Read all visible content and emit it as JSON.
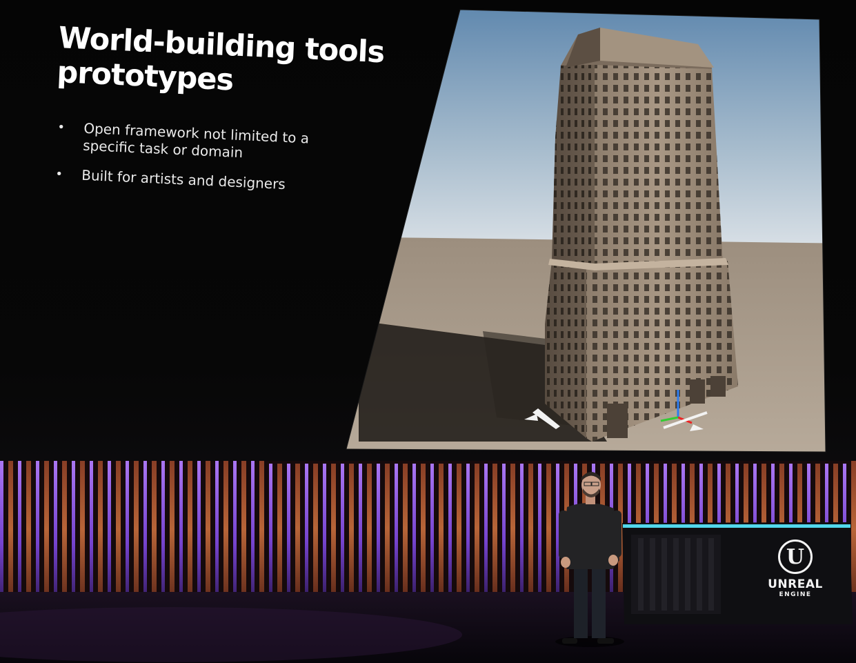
{
  "slide": {
    "title_line1": "World-building tools",
    "title_line2": "prototypes",
    "bullets": [
      "Open framework not limited to a specific task or domain",
      "Built for artists and designers"
    ]
  },
  "podium_logo": {
    "mark": "U",
    "line1": "UNREAL",
    "line2": "ENGINE"
  },
  "colors": {
    "sky_top": "#5d86ad",
    "sky_bottom": "#d9e0e6",
    "ground": "#a99b8a",
    "stage_purple": "#9a5cff",
    "stage_orange": "#e07b43",
    "podium_cyan": "#52d8ec"
  },
  "icons": {
    "gizmo": "transform-gizmo-icon",
    "bullet": "bullet-dot"
  }
}
